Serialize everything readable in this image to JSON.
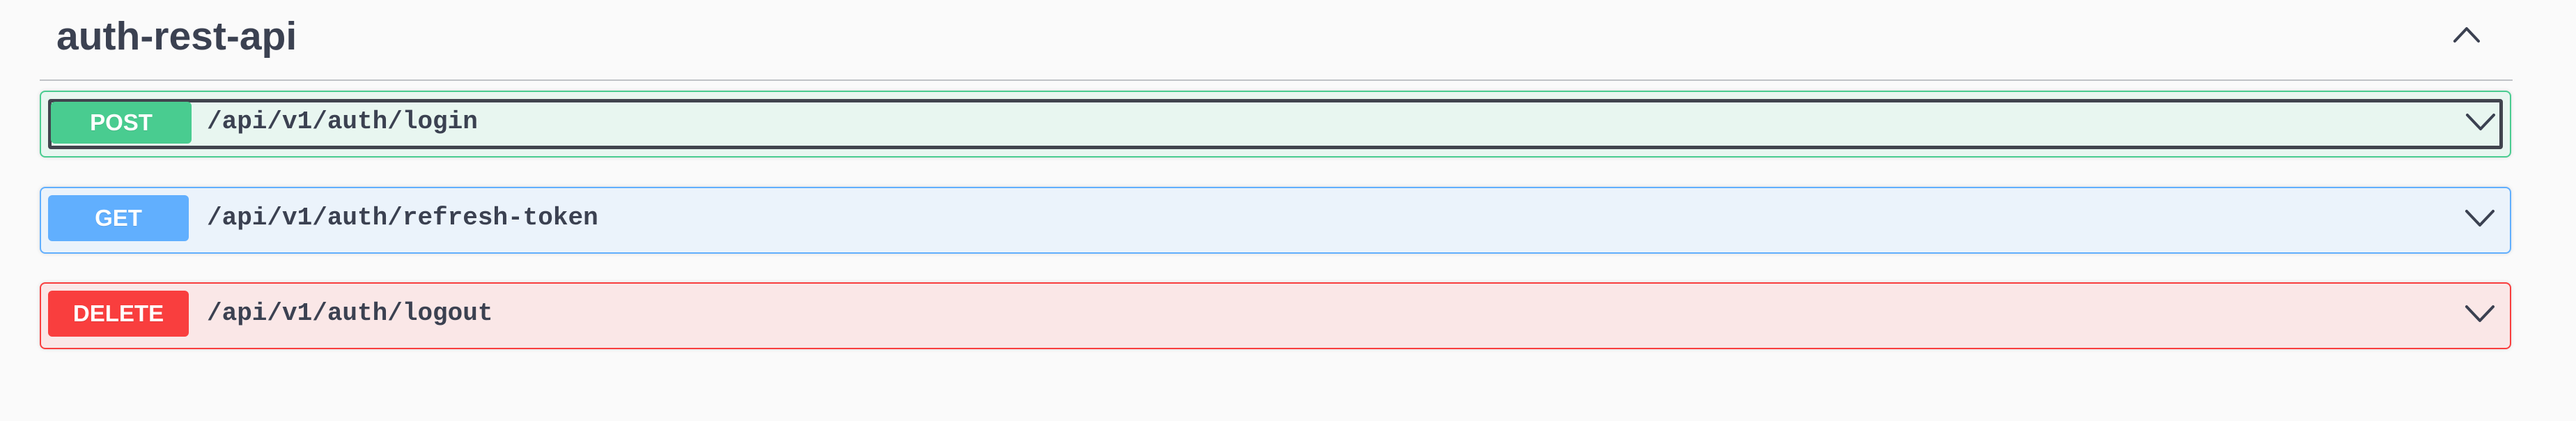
{
  "section": {
    "title": "auth-rest-api",
    "toggle_icon": "chevron-up-icon"
  },
  "operations": [
    {
      "method": "POST",
      "path": "/api/v1/auth/login",
      "color": "#49cc90",
      "background": "#e8f6f0",
      "expand_icon": "chevron-down-icon"
    },
    {
      "method": "GET",
      "path": "/api/v1/auth/refresh-token",
      "color": "#61affe",
      "background": "#ebf3fb",
      "expand_icon": "chevron-down-icon"
    },
    {
      "method": "DELETE",
      "path": "/api/v1/auth/logout",
      "color": "#f93e3e",
      "background": "#fae7e7",
      "expand_icon": "chevron-down-icon"
    }
  ],
  "colors": {
    "text": "#3b4151",
    "page_background": "#fafafa"
  }
}
